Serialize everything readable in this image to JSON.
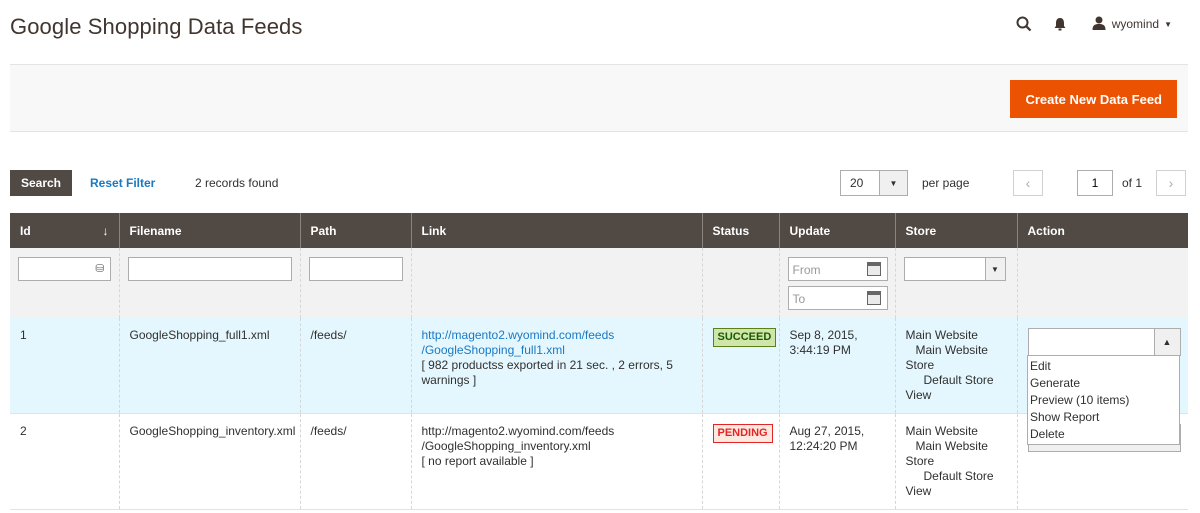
{
  "header": {
    "title": "Google Shopping Data Feeds",
    "user": "wyomind"
  },
  "actions": {
    "create_label": "Create New Data Feed"
  },
  "toolbar": {
    "search_label": "Search",
    "reset_label": "Reset Filter",
    "records": "2 records found",
    "per_page_value": "20",
    "per_page_label": "per page",
    "page_value": "1",
    "page_of": "of 1"
  },
  "columns": [
    "Id",
    "Filename",
    "Path",
    "Link",
    "Status",
    "Update",
    "Store",
    "Action"
  ],
  "filters": {
    "date_from_placeholder": "From",
    "date_to_placeholder": "To"
  },
  "rows": [
    {
      "id": "1",
      "filename": "GoogleShopping_full1.xml",
      "path": "/feeds/",
      "link_line1": "http://magento2.wyomind.com/feeds",
      "link_line2": "/GoogleShopping_full1.xml",
      "report": "[ 982 productss exported in 21 sec. , 2 errors, 5 warnings ]",
      "status": "SUCCEED",
      "update_line1": "Sep 8, 2015,",
      "update_line2": "3:44:19 PM",
      "store_website": "Main Website",
      "store_store_a": "Main Website",
      "store_store_b": "Store",
      "store_view_a": "Default Store",
      "store_view_b": "View"
    },
    {
      "id": "2",
      "filename": "GoogleShopping_inventory.xml",
      "path": "/feeds/",
      "link_line1": "http://magento2.wyomind.com/feeds",
      "link_line2": "/GoogleShopping_inventory.xml",
      "report": "[ no report available ]",
      "status": "PENDING",
      "update_line1": "Aug 27, 2015,",
      "update_line2": "12:24:20 PM",
      "store_website": "Main Website",
      "store_store_a": "Main Website",
      "store_store_b": "Store",
      "store_view_a": "Default Store",
      "store_view_b": "View"
    }
  ],
  "action_menu": [
    "Edit",
    "Generate",
    "Preview (10 items)",
    "Show Report",
    "Delete"
  ],
  "colors": {
    "accent": "#eb5202",
    "header_bg": "#514943",
    "link": "#1979c3",
    "selected_row": "#e5f7fe"
  }
}
